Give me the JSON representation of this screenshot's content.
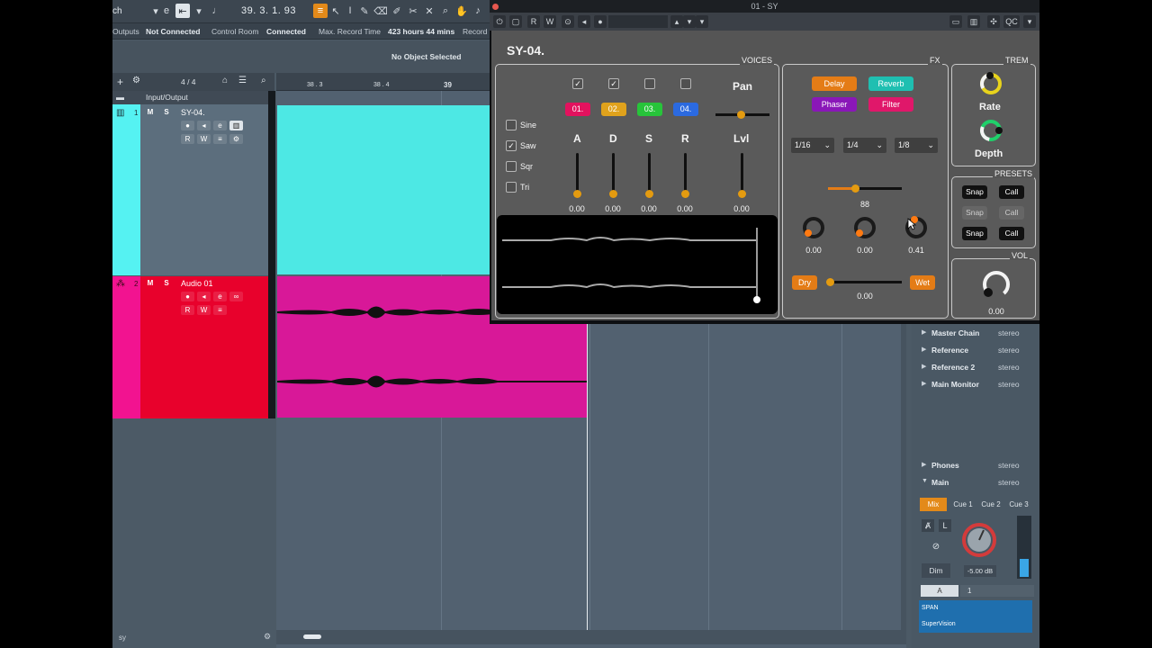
{
  "toolbar": {
    "left_text": "ch",
    "counter": "39. 3. 1. 93"
  },
  "status": {
    "outputs_label": "Outputs",
    "outputs_value": "Not Connected",
    "control_room_label": "Control Room",
    "control_room_value": "Connected",
    "max_rec_label": "Max. Record Time",
    "max_rec_value": "423 hours 44 mins",
    "record_label": "Record"
  },
  "info_line": "No Object Selected",
  "tracklist": {
    "signature": "4 / 4",
    "io_label": "Input/Output",
    "tracks": [
      {
        "num": "1",
        "name": "SY-04.",
        "m": "M",
        "s": "S",
        "r": "R",
        "w": "W"
      },
      {
        "num": "2",
        "name": "Audio 01",
        "m": "M",
        "s": "S",
        "r": "R",
        "w": "W"
      }
    ],
    "footer": "sy"
  },
  "ruler": {
    "ticks": [
      "38 . 3",
      "38 . 4",
      "39"
    ]
  },
  "plugin": {
    "window_title": "01 - SY",
    "name": "SY-04.",
    "voices_title": "VOICES",
    "fx_title": "FX",
    "trem_title": "TREM",
    "presets_title": "PRESETS",
    "vol_title": "VOL",
    "waves": [
      "Sine",
      "Saw",
      "Sqr",
      "Tri"
    ],
    "voices": [
      "01.",
      "02.",
      "03.",
      "04."
    ],
    "voice_colors": [
      "#e3125e",
      "#e0a21c",
      "#27c43a",
      "#2b6ae0"
    ],
    "pan_label": "Pan",
    "lvl_label": "Lvl",
    "adsr": [
      {
        "label": "A",
        "value": "0.00"
      },
      {
        "label": "D",
        "value": "0.00"
      },
      {
        "label": "S",
        "value": "0.00"
      },
      {
        "label": "R",
        "value": "0.00"
      }
    ],
    "lvl_value": "0.00",
    "fx_buttons": [
      {
        "label": "Delay",
        "color": "#e47c16"
      },
      {
        "label": "Reverb",
        "color": "#1fbfb1"
      },
      {
        "label": "Phaser",
        "color": "#8a17b8"
      },
      {
        "label": "Filter",
        "color": "#e0176a"
      }
    ],
    "dropdowns": [
      "1/16",
      "1/4",
      "1/8"
    ],
    "fx_slider_value": "88",
    "fx_knobs": [
      "0.00",
      "0.00",
      "0.41"
    ],
    "dry_label": "Dry",
    "wet_label": "Wet",
    "drywet_value": "0.00",
    "rate_label": "Rate",
    "depth_label": "Depth",
    "presets": [
      {
        "snap": "Snap",
        "call": "Call"
      },
      {
        "snap": "Snap",
        "call": "Call"
      },
      {
        "snap": "Snap",
        "call": "Call"
      }
    ],
    "vol_value": "0.00"
  },
  "mixer": {
    "rows_top": [
      {
        "name": "Master Chain",
        "mode": "stereo"
      },
      {
        "name": "Reference",
        "mode": "stereo"
      },
      {
        "name": "Reference 2",
        "mode": "stereo"
      },
      {
        "name": "Main Monitor",
        "mode": "stereo"
      }
    ],
    "rows_bottom": [
      {
        "name": "Phones",
        "mode": "stereo"
      },
      {
        "name": "Main",
        "mode": "stereo"
      }
    ],
    "tabs": [
      "Mix",
      "Cue 1",
      "Cue 2",
      "Cue 3"
    ],
    "dim_label": "Dim",
    "db_value": "-5.00 dB",
    "slot_a": "A",
    "slot_num": "1",
    "inserts": [
      "SPAN",
      "SuperVision"
    ]
  }
}
